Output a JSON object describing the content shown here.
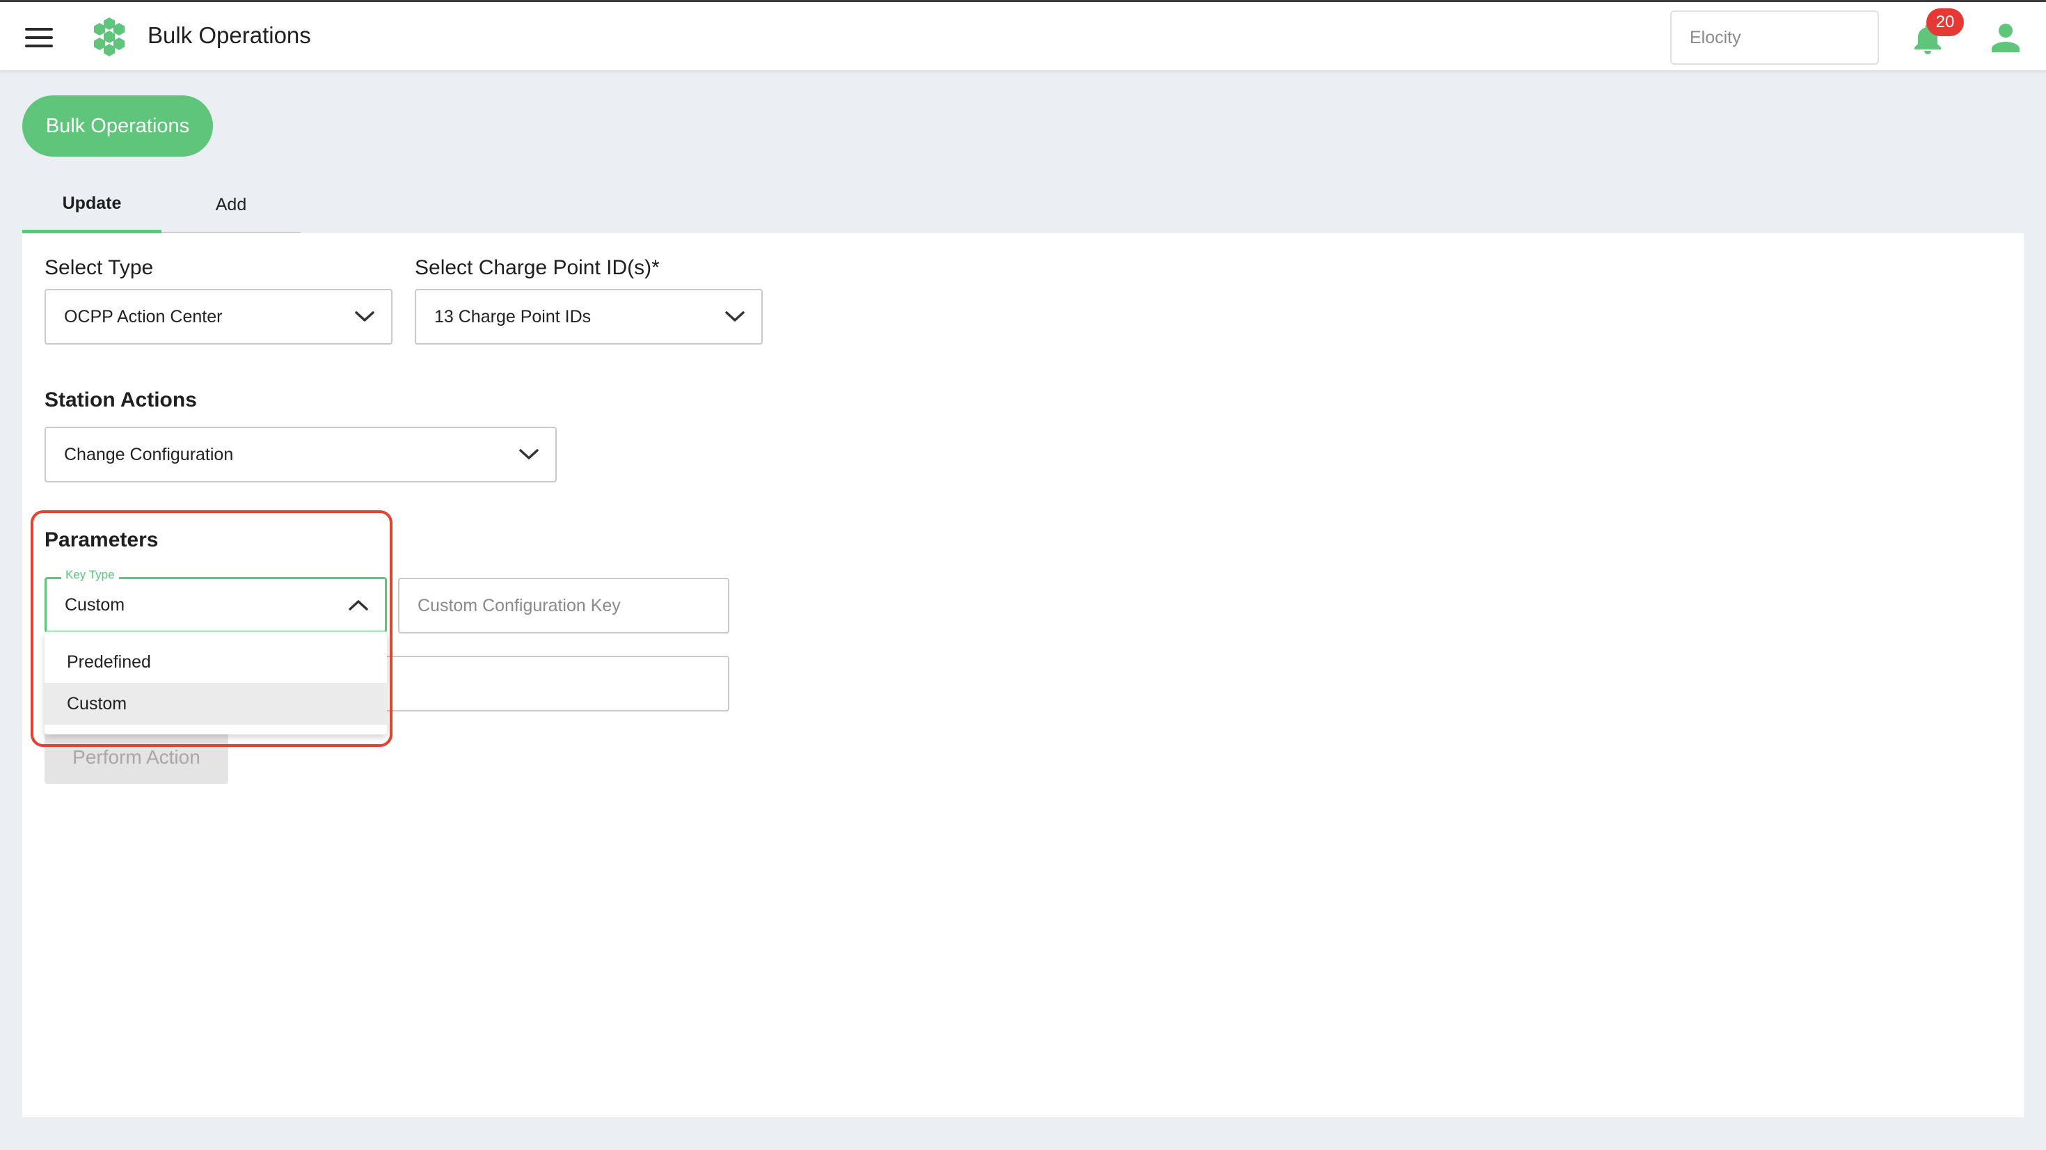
{
  "header": {
    "app_title": "Bulk Operations",
    "org_value": "Elocity",
    "notification_count": "20",
    "brand_color": "#5ec57b"
  },
  "page": {
    "main_button": "Bulk Operations",
    "tabs": [
      {
        "label": "Update",
        "active": true
      },
      {
        "label": "Add",
        "active": false
      }
    ]
  },
  "form": {
    "select_type_label": "Select Type",
    "select_type_value": "OCPP Action Center",
    "charge_point_label": "Select Charge Point ID(s)*",
    "charge_point_value": "13 Charge Point IDs",
    "station_actions_label": "Station Actions",
    "station_actions_value": "Change Configuration",
    "parameters_label": "Parameters",
    "key_type_legend": "Key Type",
    "key_type_value": "Custom",
    "custom_key_placeholder": "Custom Configuration Key",
    "value_input_placeholder": "",
    "key_type_options": [
      "Predefined",
      "Custom"
    ],
    "selected_option": "Custom",
    "perform_button": "Perform Action"
  },
  "annotation": {
    "highlight_color": "#e4412f"
  }
}
